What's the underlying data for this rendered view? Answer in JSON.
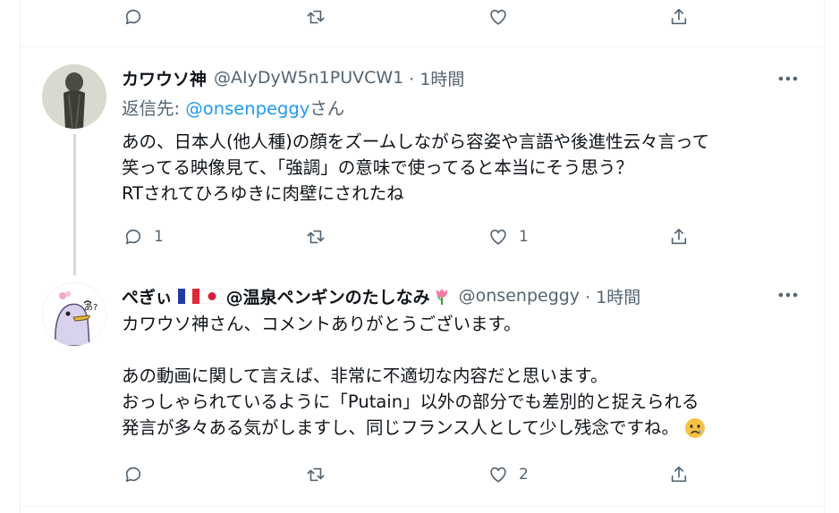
{
  "top_actions": {
    "reply_count": "",
    "retweet_count": "",
    "like_count": ""
  },
  "tweet1": {
    "display_name": "カワウソ神",
    "handle": "@AIyDyW5n1PUVCW1",
    "time": "· 1時間",
    "reply_to_label": "返信先:",
    "reply_to_handle": "@onsenpeggy",
    "reply_to_suffix": "さん",
    "text_lines": [
      "あの、日本人(他人種)の顔をズームしながら容姿や言語や後進性云々言って",
      "笑ってる映像見て、「強調」の意味で使ってると本当にそう思う？",
      "RTされてひろゆきに肉壁にされたね"
    ],
    "reply_count": "1",
    "retweet_count": "",
    "like_count": "1"
  },
  "tweet2": {
    "display_name": "ぺぎぃ",
    "display_name_suffix": "@温泉ペンギンのたしなみ",
    "flags": [
      "flag-france-icon",
      "flag-japan-icon"
    ],
    "name_emoji": "tulip-icon",
    "handle": "@onsenpeggy",
    "time": "· 1時間",
    "text_lines": [
      "カワウソ神さん、コメントありがとうございます。",
      "",
      "あの動画に関して言えば、非常に不適切な内容だと思います。",
      "おっしゃられているように「Putain」以外の部分でも差別的と捉えられる",
      "発言が多々ある気がしますし、同じフランス人として少し残念ですね。"
    ],
    "trailing_emoji": "sad-but-relieved-face-icon",
    "reply_count": "",
    "retweet_count": "",
    "like_count": "2"
  },
  "colors": {
    "text": "#0f1419",
    "secondary": "#536471",
    "link": "#1d9bf0",
    "border": "#eff3f4",
    "thread_line": "#cfd9de"
  }
}
